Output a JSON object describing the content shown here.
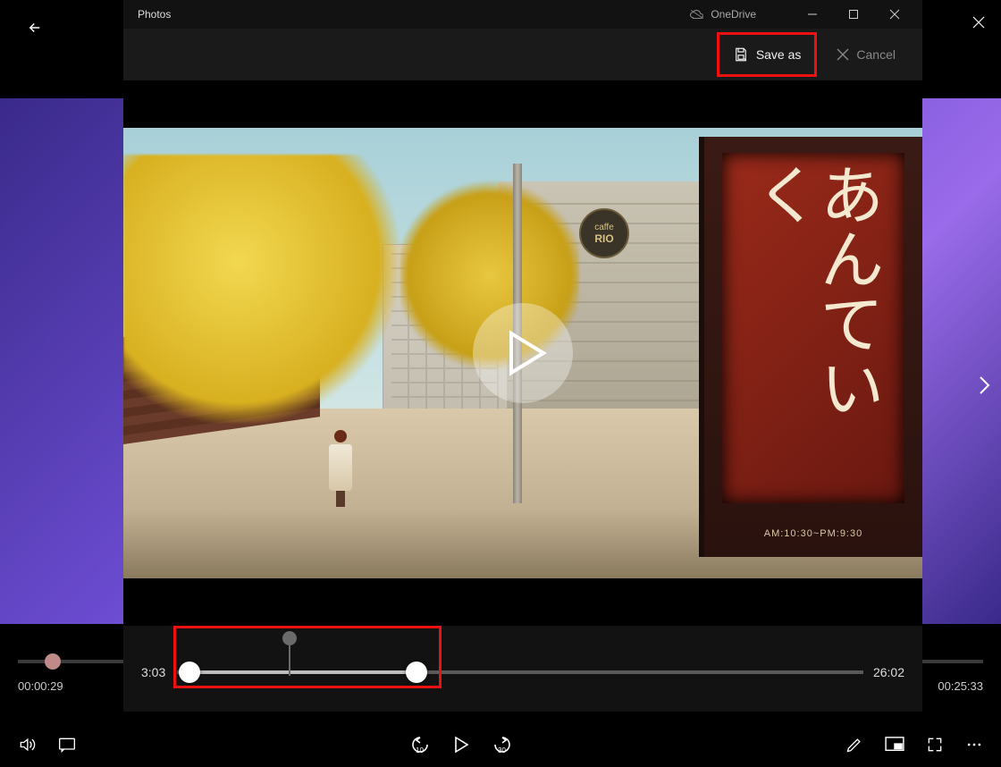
{
  "bg": {
    "time_current": "00:00:29",
    "time_total": "00:25:33"
  },
  "dialog": {
    "title": "Photos",
    "onedrive_label": "OneDrive",
    "save_as_label": "Save as",
    "cancel_label": "Cancel",
    "caffe_top": "caffe",
    "caffe_name": "RIO",
    "sign_calligraphy": "あんていく",
    "sign_hours": "AM:10:30~PM:9:30",
    "trim_start": "3:03",
    "trim_end": "26:02"
  }
}
